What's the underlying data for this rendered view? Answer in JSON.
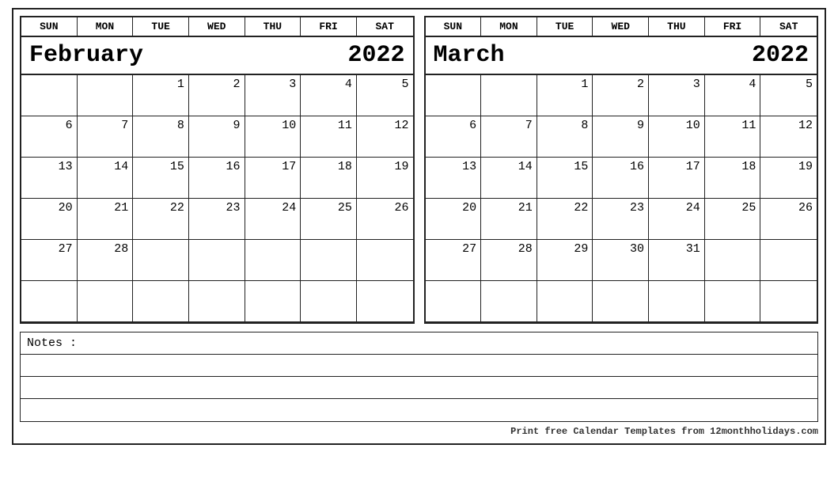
{
  "february": {
    "month_name": "February",
    "year": "2022",
    "days_header": [
      "SUN",
      "MON",
      "TUE",
      "WED",
      "THU",
      "FRI",
      "SAT"
    ],
    "weeks": [
      [
        "",
        "",
        "1",
        "2",
        "3",
        "4",
        "5"
      ],
      [
        "6",
        "7",
        "8",
        "9",
        "10",
        "11",
        "12"
      ],
      [
        "13",
        "14",
        "15",
        "16",
        "17",
        "18",
        "19"
      ],
      [
        "20",
        "21",
        "22",
        "23",
        "24",
        "25",
        "26"
      ],
      [
        "27",
        "28",
        "",
        "",
        "",
        "",
        ""
      ],
      [
        "",
        "",
        "",
        "",
        "",
        "",
        ""
      ]
    ]
  },
  "march": {
    "month_name": "March",
    "year": "2022",
    "days_header": [
      "SUN",
      "MON",
      "TUE",
      "WED",
      "THU",
      "FRI",
      "SAT"
    ],
    "weeks": [
      [
        "",
        "",
        "1",
        "2",
        "3",
        "4",
        "5"
      ],
      [
        "6",
        "7",
        "8",
        "9",
        "10",
        "11",
        "12"
      ],
      [
        "13",
        "14",
        "15",
        "16",
        "17",
        "18",
        "19"
      ],
      [
        "20",
        "21",
        "22",
        "23",
        "24",
        "25",
        "26"
      ],
      [
        "27",
        "28",
        "29",
        "30",
        "31",
        "",
        ""
      ],
      [
        "",
        "",
        "",
        "",
        "",
        "",
        ""
      ]
    ]
  },
  "notes": {
    "label": "Notes :",
    "lines": 4
  },
  "footer": {
    "text": "Print free Calendar Templates from ",
    "brand": "12monthholidays.com"
  }
}
